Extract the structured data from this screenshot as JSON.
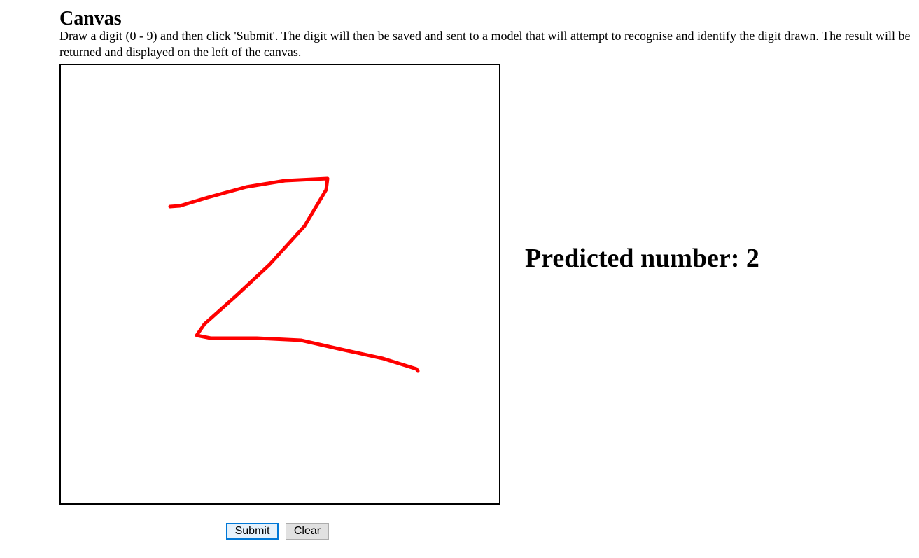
{
  "page": {
    "title": "Canvas",
    "instructions": "Draw a digit (0 - 9) and then click 'Submit'. The digit will then be saved and sent to a model that will attempt to recognise and identify the digit drawn. The result will be returned and displayed on the left of the canvas."
  },
  "canvas": {
    "stroke_color": "#ff0000",
    "background": "#ffffff",
    "border_color": "#000000"
  },
  "result": {
    "prediction_text": "Predicted number: 2"
  },
  "buttons": {
    "submit_label": "Submit",
    "clear_label": "Clear"
  }
}
